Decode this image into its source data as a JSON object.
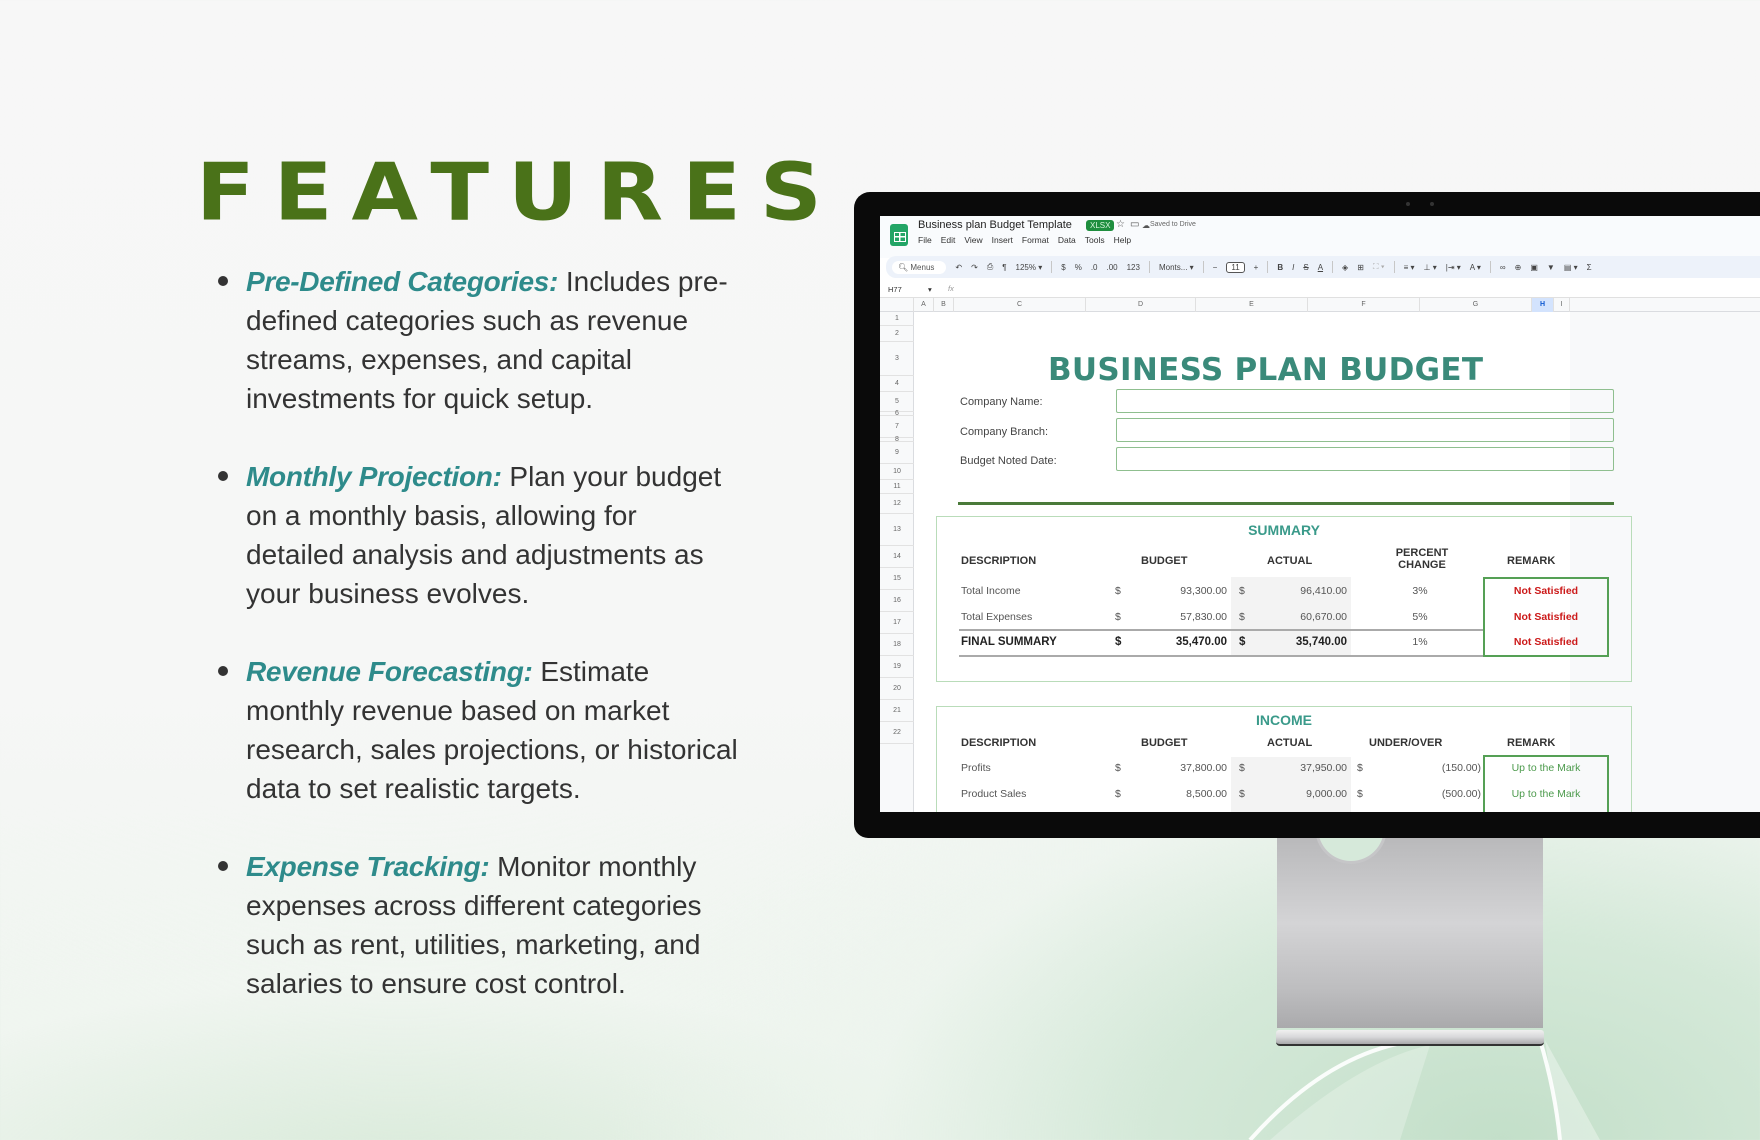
{
  "heading": "FEATURES",
  "features": [
    {
      "title": "Pre-Defined Categories:",
      "lines": [
        "Includes pre-",
        "defined categories such as revenue",
        "streams, expenses, and capital",
        "investments for quick setup."
      ]
    },
    {
      "title": "Monthly Projection:",
      "lines": [
        "Plan your budget",
        "on a monthly basis, allowing for",
        "detailed analysis and adjustments as",
        "your business evolves."
      ]
    },
    {
      "title": "Revenue Forecasting:",
      "lines": [
        "Estimate",
        "monthly revenue based on market",
        "research, sales projections, or historical",
        "data to set realistic targets."
      ]
    },
    {
      "title": "Expense Tracking:",
      "lines": [
        "Monitor monthly",
        "expenses across different categories",
        "such as rent, utilities, marketing, and",
        "salaries to ensure cost control."
      ]
    }
  ],
  "sheets": {
    "doc_title": "Business plan Budget Template",
    "file_badge": "XLSX",
    "saved_status": "Saved to Drive",
    "menu": [
      "File",
      "Edit",
      "View",
      "Insert",
      "Format",
      "Data",
      "Tools",
      "Help"
    ],
    "toolbar": {
      "search": "Menus",
      "zoom": "125%",
      "currency": "$",
      "percent": "%",
      "dec_less": ".0",
      "dec_more": ".00",
      "number_format": "123",
      "font": "Monts...",
      "font_size": "11"
    },
    "cell_ref": "H77",
    "fx": "fx",
    "columns": [
      "A",
      "B",
      "C",
      "D",
      "E",
      "F",
      "G",
      "H",
      "I"
    ],
    "selected_column": "H",
    "rows": [
      "1",
      "2",
      "3",
      "4",
      "5",
      "6",
      "7",
      "8",
      "9",
      "10",
      "11",
      "12",
      "13",
      "14",
      "15",
      "16",
      "17",
      "18",
      "19",
      "20",
      "21",
      "22"
    ],
    "sheet_title": "BUSINESS PLAN BUDGET",
    "fields": [
      {
        "label": "Company Name:",
        "value": ""
      },
      {
        "label": "Company Branch:",
        "value": ""
      },
      {
        "label": "Budget  Noted Date:",
        "value": ""
      }
    ],
    "summary": {
      "title": "SUMMARY",
      "headers": [
        "DESCRIPTION",
        "BUDGET",
        "ACTUAL",
        "PERCENT CHANGE",
        "REMARK"
      ],
      "rows": [
        {
          "description": "Total Income",
          "budget": "93,300.00",
          "actual": "96,410.00",
          "change": "3%",
          "remark": "Not Satisfied"
        },
        {
          "description": "Total Expenses",
          "budget": "57,830.00",
          "actual": "60,670.00",
          "change": "5%",
          "remark": "Not Satisfied"
        },
        {
          "description": "FINAL SUMMARY",
          "budget": "35,470.00",
          "actual": "35,740.00",
          "change": "1%",
          "remark": "Not Satisfied"
        }
      ]
    },
    "income": {
      "title": "INCOME",
      "headers": [
        "DESCRIPTION",
        "BUDGET",
        "ACTUAL",
        "UNDER/OVER",
        "REMARK"
      ],
      "rows": [
        {
          "description": "Profits",
          "budget": "37,800.00",
          "actual": "37,950.00",
          "diff": "(150.00)",
          "remark": "Up to the Mark"
        },
        {
          "description": "Product Sales",
          "budget": "8,500.00",
          "actual": "9,000.00",
          "diff": "(500.00)",
          "remark": "Up to the Mark"
        }
      ]
    },
    "currency_symbol": "$"
  },
  "colors": {
    "heading_green": "#4a7219",
    "feature_teal": "#2e8b8b",
    "sheet_title_teal": "#3a8a7a",
    "remark_red": "#cc1a1a",
    "remark_green": "#4c9a4c"
  }
}
